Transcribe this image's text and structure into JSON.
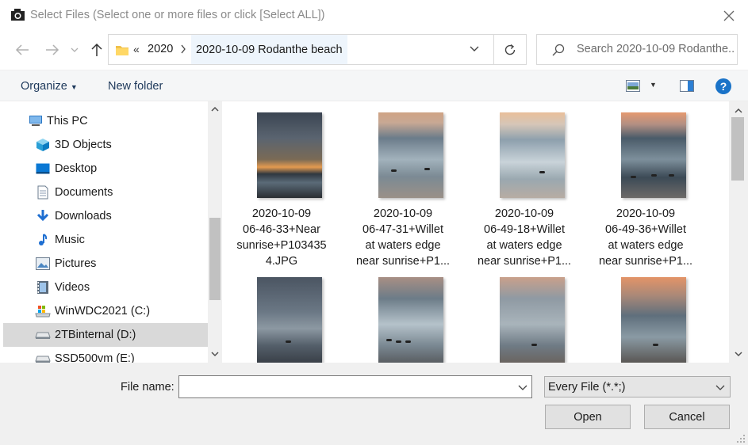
{
  "window": {
    "title": "Select Files (Select one or more files or click [Select ALL])"
  },
  "address": {
    "overflow": "«",
    "crumbs": [
      "2020",
      "2020-10-09 Rodanthe beach"
    ]
  },
  "search": {
    "placeholder": "Search 2020-10-09 Rodanthe..."
  },
  "commands": {
    "organize": "Organize",
    "new_folder": "New folder"
  },
  "sidebar": {
    "items": [
      {
        "label": "This PC",
        "icon": "pc-icon"
      },
      {
        "label": "3D Objects",
        "icon": "3d-objects-icon"
      },
      {
        "label": "Desktop",
        "icon": "desktop-icon"
      },
      {
        "label": "Documents",
        "icon": "documents-icon"
      },
      {
        "label": "Downloads",
        "icon": "downloads-icon"
      },
      {
        "label": "Music",
        "icon": "music-icon"
      },
      {
        "label": "Pictures",
        "icon": "pictures-icon"
      },
      {
        "label": "Videos",
        "icon": "videos-icon"
      },
      {
        "label": "WinWDC2021 (C:)",
        "icon": "system-drive-icon"
      },
      {
        "label": "2TBinternal (D:)",
        "icon": "drive-icon",
        "selected": true
      },
      {
        "label": "SSD500vm (E:)",
        "icon": "drive-icon"
      }
    ]
  },
  "files": [
    {
      "name": "2020-10-09 06-46-33+Near sunrise+P1034354.JPG",
      "lines": [
        "2020-10-09",
        "06-46-33+Near",
        "sunrise+P103435",
        "4.JPG"
      ]
    },
    {
      "name": "2020-10-09 06-47-31+Willet at waters edge near sunrise+P1...",
      "lines": [
        "2020-10-09",
        "06-47-31+Willet",
        "at waters edge",
        "near sunrise+P1..."
      ]
    },
    {
      "name": "2020-10-09 06-49-18+Willet at waters edge near sunrise+P1...",
      "lines": [
        "2020-10-09",
        "06-49-18+Willet",
        "at waters edge",
        "near sunrise+P1..."
      ]
    },
    {
      "name": "2020-10-09 06-49-36+Willet at waters edge near sunrise+P1...",
      "lines": [
        "2020-10-09",
        "06-49-36+Willet",
        "at waters edge",
        "near sunrise+P1..."
      ]
    },
    {
      "name": "",
      "lines": []
    },
    {
      "name": "",
      "lines": []
    },
    {
      "name": "",
      "lines": []
    },
    {
      "name": "",
      "lines": []
    }
  ],
  "footer": {
    "file_name_label": "File name:",
    "file_name_value": "",
    "file_type": "Every File  (*.*;)",
    "open_label": "Open",
    "cancel_label": "Cancel"
  },
  "colors": {
    "accent": "#0078d7",
    "selection": "#d9d9d9",
    "help": "#1a73c8"
  }
}
